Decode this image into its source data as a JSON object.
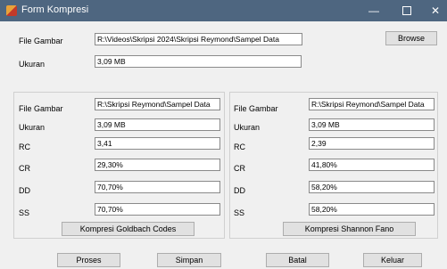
{
  "window": {
    "title": "Form Kompresi",
    "controls": {
      "minimize": "—",
      "close": "✕"
    }
  },
  "top": {
    "file_label": "File Gambar",
    "file_value": "R:\\Videos\\Skripsi 2024\\Skripsi Reymond\\Sampel Data",
    "browse_label": "Browse",
    "size_label": "Ukuran",
    "size_value": "3,09 MB"
  },
  "left_panel": {
    "file_label": "File Gambar",
    "file_value": "R:\\Skripsi Reymond\\Sampel Data",
    "size_label": "Ukuran",
    "size_value": "3,09 MB",
    "rc_label": "RC",
    "rc_value": "3,41",
    "cr_label": "CR",
    "cr_value": "29,30%",
    "dd_label": "DD",
    "dd_value": "70,70%",
    "ss_label": "SS",
    "ss_value": "70,70%",
    "button_label": "Kompresi Goldbach Codes"
  },
  "right_panel": {
    "file_label": "File Gambar",
    "file_value": "R:\\Skripsi Reymond\\Sampel Data",
    "size_label": "Ukuran",
    "size_value": "3,09 MB",
    "rc_label": "RC",
    "rc_value": "2,39",
    "cr_label": "CR",
    "cr_value": "41,80%",
    "dd_label": "DD",
    "dd_value": "58,20%",
    "ss_label": "SS",
    "ss_value": "58,20%",
    "button_label": "Kompresi Shannon Fano"
  },
  "footer": {
    "proses": "Proses",
    "simpan": "Simpan",
    "batal": "Batal",
    "keluar": "Keluar"
  }
}
